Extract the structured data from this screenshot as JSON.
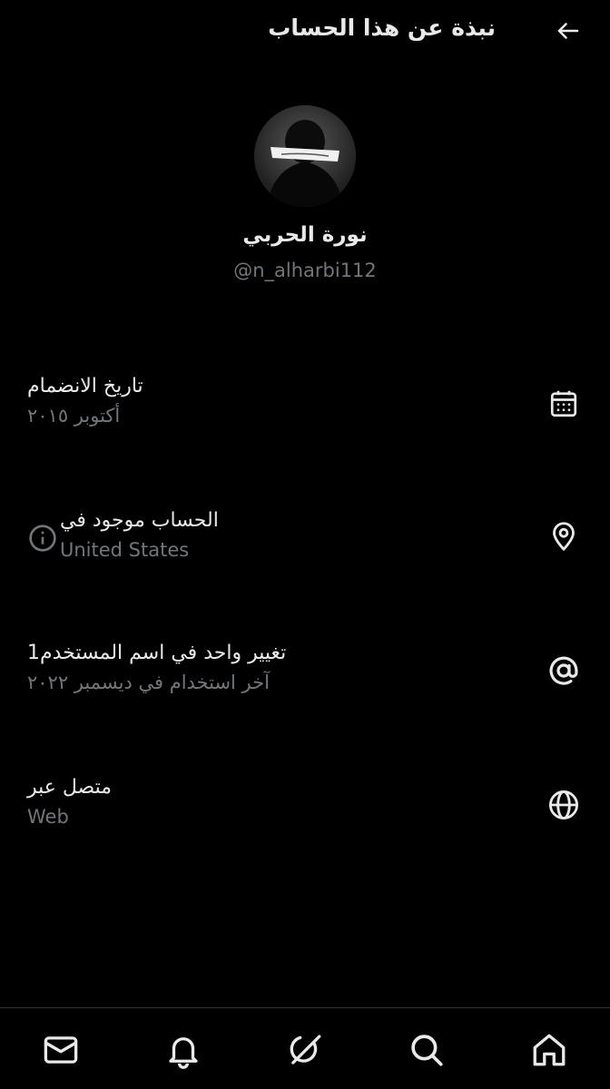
{
  "header": {
    "title": "نبذة عن هذا الحساب",
    "back_icon": "arrow-right-icon"
  },
  "profile": {
    "display_name": "نورة الحربي",
    "handle": "@n_alharbi112",
    "avatar_icon": "avatar-image"
  },
  "rows": [
    {
      "icon": "calendar-icon",
      "label": "تاريخ الانضمام",
      "value": "أكتوبر ٢٠١٥"
    },
    {
      "icon": "location-pin-icon",
      "label": "الحساب موجود في",
      "value": "United States",
      "extra_icon": "info-icon"
    },
    {
      "icon": "at-sign-icon",
      "label": "تغيير واحد في اسم المستخدم1",
      "value": "آخر استخدام في ديسمبر ٢٠٢٢"
    },
    {
      "icon": "globe-icon",
      "label": "متصل عبر",
      "value": "Web"
    }
  ],
  "bottom_nav": [
    "mail-icon",
    "bell-icon",
    "grok-icon",
    "search-icon",
    "home-icon"
  ],
  "colors": {
    "background": "#000000",
    "text_primary": "#e7e9ea",
    "text_secondary": "#71767b",
    "divider": "#2f3336"
  }
}
